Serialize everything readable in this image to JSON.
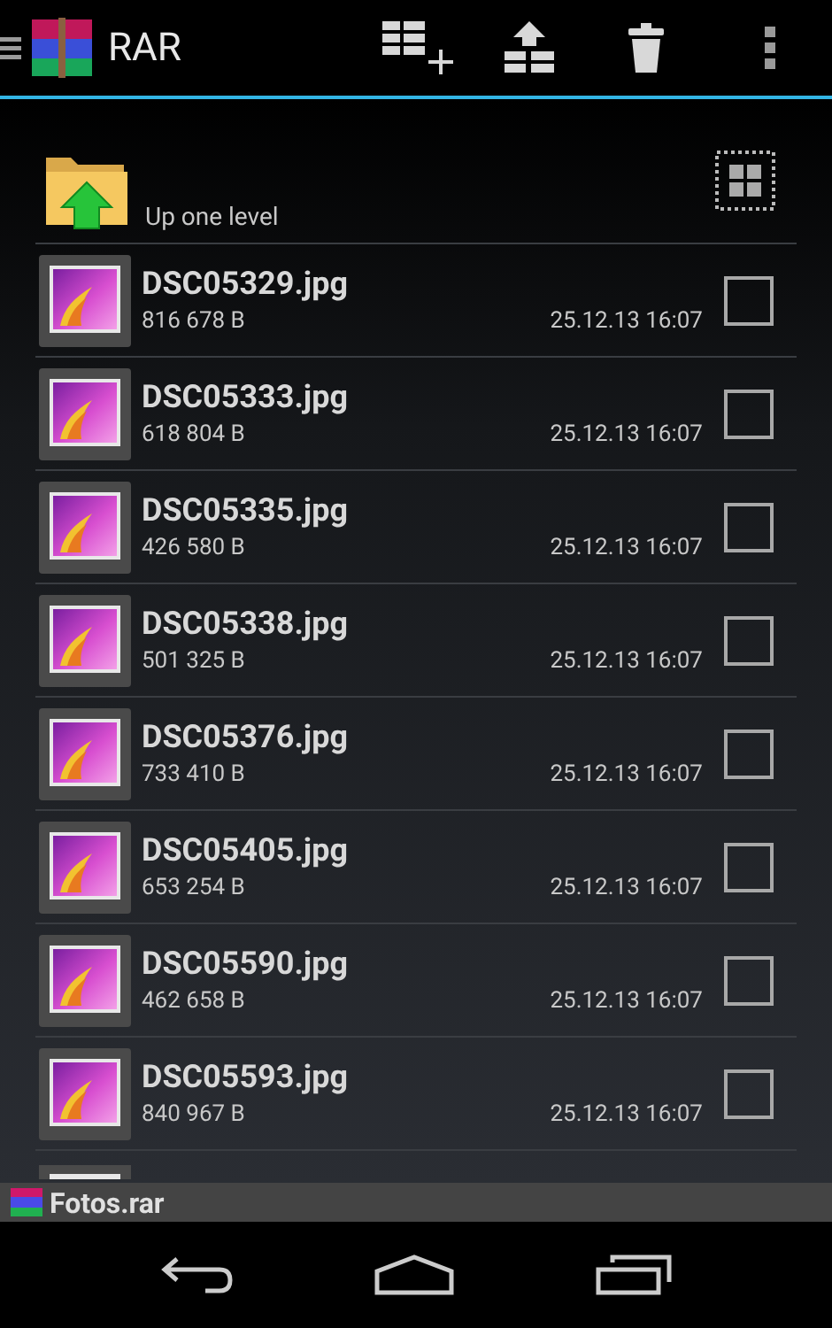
{
  "action_bar": {
    "title": "RAR"
  },
  "up_item": {
    "label": "Up one level"
  },
  "files": [
    {
      "name": "DSC05329.jpg",
      "size": "816 678 B",
      "date": "25.12.13 16:07",
      "checked": false
    },
    {
      "name": "DSC05333.jpg",
      "size": "618 804 B",
      "date": "25.12.13 16:07",
      "checked": false
    },
    {
      "name": "DSC05335.jpg",
      "size": "426 580 B",
      "date": "25.12.13 16:07",
      "checked": false
    },
    {
      "name": "DSC05338.jpg",
      "size": "501 325 B",
      "date": "25.12.13 16:07",
      "checked": false
    },
    {
      "name": "DSC05376.jpg",
      "size": "733 410 B",
      "date": "25.12.13 16:07",
      "checked": false
    },
    {
      "name": "DSC05405.jpg",
      "size": "653 254 B",
      "date": "25.12.13 16:07",
      "checked": false
    },
    {
      "name": "DSC05590.jpg",
      "size": "462 658 B",
      "date": "25.12.13 16:07",
      "checked": false
    },
    {
      "name": "DSC05593.jpg",
      "size": "840 967 B",
      "date": "25.12.13 16:07",
      "checked": false
    }
  ],
  "status_bar": {
    "archive": "Fotos.rar"
  }
}
